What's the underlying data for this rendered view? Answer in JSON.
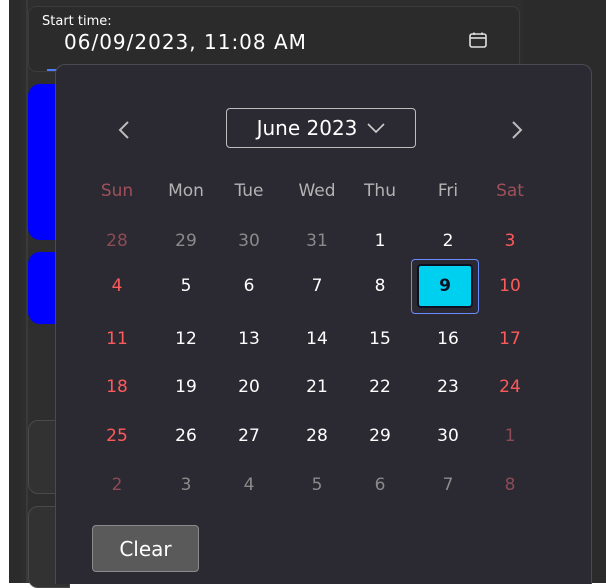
{
  "field": {
    "label": "Start time:",
    "value": "06/09/2023, 11:08 AM"
  },
  "calendar": {
    "month_label": "June 2023",
    "weekdays": [
      "Sun",
      "Mon",
      "Tue",
      "Wed",
      "Thu",
      "Fri",
      "Sat"
    ],
    "weeks": [
      [
        "28",
        "29",
        "30",
        "31",
        "1",
        "2",
        "3"
      ],
      [
        "4",
        "5",
        "6",
        "7",
        "8",
        "9",
        "10"
      ],
      [
        "11",
        "12",
        "13",
        "14",
        "15",
        "16",
        "17"
      ],
      [
        "18",
        "19",
        "20",
        "21",
        "22",
        "23",
        "24"
      ],
      [
        "25",
        "26",
        "27",
        "28",
        "29",
        "30",
        "1"
      ],
      [
        "2",
        "3",
        "4",
        "5",
        "6",
        "7",
        "8"
      ]
    ],
    "selected_day": "9",
    "clear_label": "Clear"
  },
  "colors": {
    "selected_fill": "#00d0f0",
    "weekend": "#ff5a5a",
    "side_blue": "#0000ff"
  }
}
